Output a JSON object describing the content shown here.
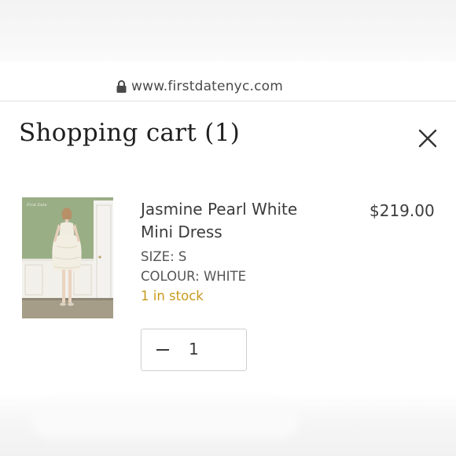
{
  "browser": {
    "url": "www.firstdatenyc.com",
    "secure_icon": "lock-icon"
  },
  "cart": {
    "title": "Shopping cart (1)",
    "close_icon": "close-icon"
  },
  "item": {
    "name_line1": "Jasmine Pearl White",
    "name_line2": "Mini Dress",
    "price": "$219.00",
    "size": "SIZE: S",
    "colour": "COLOUR: WHITE",
    "stock": "1 in stock",
    "quantity": "1",
    "minus_icon": "minus-icon",
    "image_watermark": "First Date"
  },
  "colors": {
    "stock": "#c79a1c",
    "image_wall": "#8fa37a",
    "dress": "#f1ece0"
  }
}
